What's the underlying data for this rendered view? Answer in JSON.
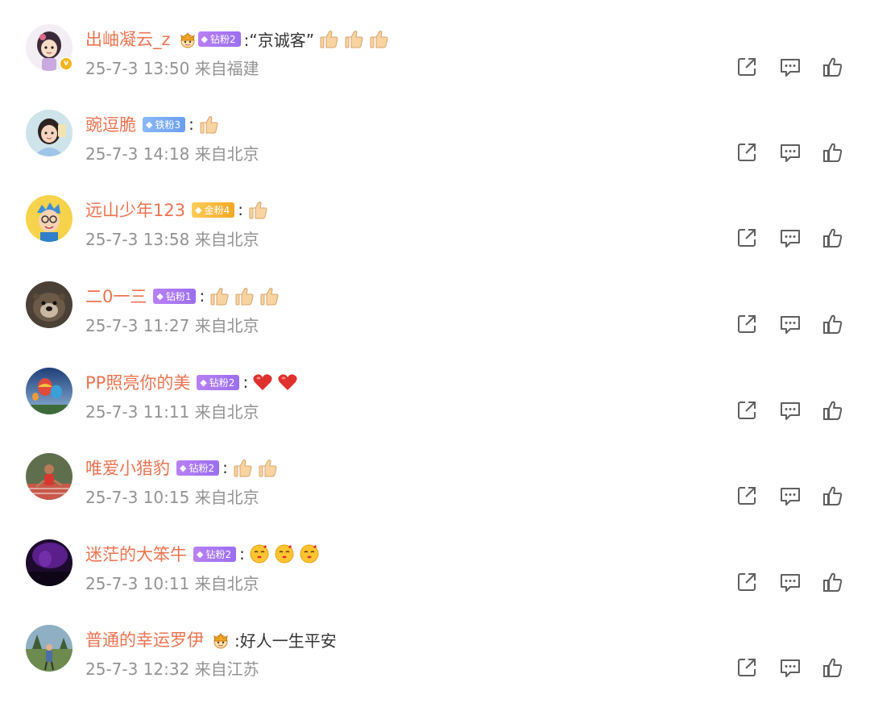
{
  "comments": [
    {
      "username": "出岫凝云_z",
      "badge": {
        "kind": "crown-zuan",
        "label": "钻粉2"
      },
      "verified": true,
      "content_text": ":“京诚客”",
      "emojis": [
        "thumbs-up-emoji",
        "thumbs-up-emoji",
        "thumbs-up-emoji"
      ],
      "time": "25-7-3 13:50",
      "location": "来自福建",
      "avatar": "girl-avatar"
    },
    {
      "username": "豌逗脆",
      "badge": {
        "kind": "tie",
        "label": "铁粉3"
      },
      "verified": false,
      "content_text": ":",
      "emojis": [
        "thumbs-up-emoji"
      ],
      "time": "25-7-3 14:18",
      "location": "来自北京",
      "avatar": "cartoon-girl-avatar"
    },
    {
      "username": "远山少年123",
      "badge": {
        "kind": "jin",
        "label": "金粉4"
      },
      "verified": false,
      "content_text": ":",
      "emojis": [
        "thumbs-up-emoji"
      ],
      "time": "25-7-3 13:58",
      "location": "来自北京",
      "avatar": "cartoon-boy-avatar"
    },
    {
      "username": "二0一三",
      "badge": {
        "kind": "zuan",
        "label": "钻粉1"
      },
      "verified": false,
      "content_text": ":",
      "emojis": [
        "thumbs-up-emoji",
        "thumbs-up-emoji",
        "thumbs-up-emoji"
      ],
      "time": "25-7-3 11:27",
      "location": "来自北京",
      "avatar": "otter-avatar"
    },
    {
      "username": "PP照亮你的美",
      "badge": {
        "kind": "zuan",
        "label": "钻粉2"
      },
      "verified": false,
      "content_text": ":",
      "emojis": [
        "heart-emoji",
        "heart-emoji"
      ],
      "time": "25-7-3 11:11",
      "location": "来自北京",
      "avatar": "balloon-avatar"
    },
    {
      "username": "唯爱小猎豹",
      "badge": {
        "kind": "zuan",
        "label": "钻粉2"
      },
      "verified": false,
      "content_text": ":",
      "emojis": [
        "thumbs-up-emoji",
        "thumbs-up-emoji"
      ],
      "time": "25-7-3 10:15",
      "location": "来自北京",
      "avatar": "athlete-avatar"
    },
    {
      "username": "迷茫的大笨牛",
      "badge": {
        "kind": "zuan",
        "label": "钻粉2"
      },
      "verified": false,
      "content_text": ":",
      "emojis": [
        "kiss-emoji",
        "kiss-emoji",
        "kiss-emoji"
      ],
      "time": "25-7-3 10:11",
      "location": "来自北京",
      "avatar": "purple-avatar"
    },
    {
      "username": "普通的幸运罗伊",
      "badge": {
        "kind": "crown",
        "label": ""
      },
      "verified": false,
      "content_text": ":好人一生平安",
      "emojis": [],
      "time": "25-7-3 12:32",
      "location": "来自江苏",
      "avatar": "outdoor-avatar"
    }
  ],
  "colors": {
    "username": "#eb7350",
    "meta": "#939393",
    "icon": "#5f5f5f",
    "zuan_badge": "#a778f3",
    "tie_badge": "#7aa9f4",
    "jin_badge": "#f8b83a"
  },
  "action_icons": [
    "share-icon",
    "comment-icon",
    "like-icon"
  ]
}
